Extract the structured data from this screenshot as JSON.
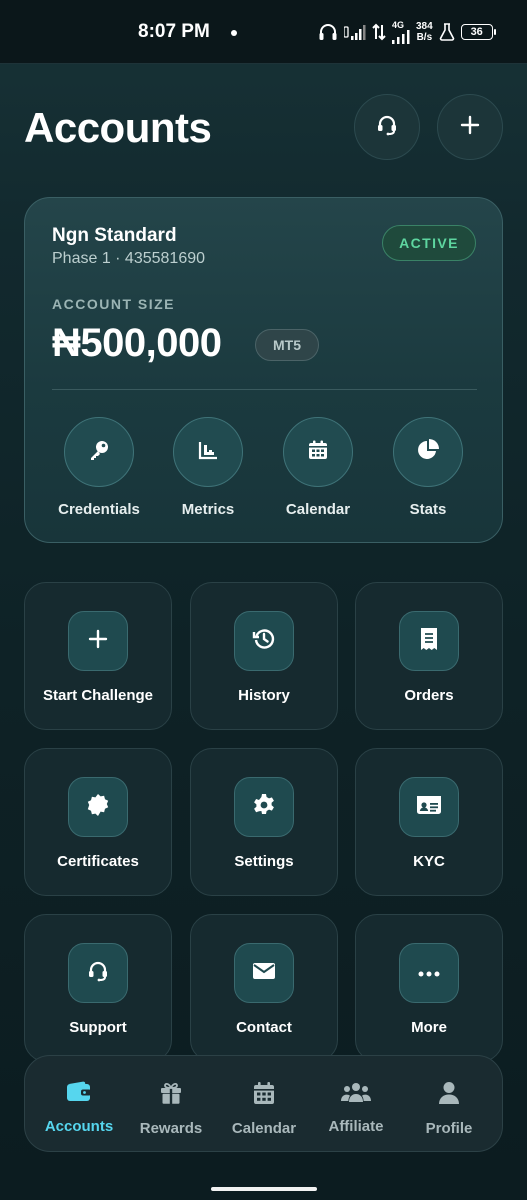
{
  "status_bar": {
    "time": "8:07 PM",
    "network": "4G",
    "speed_value": "384",
    "speed_unit": "B/s",
    "battery": "36"
  },
  "header": {
    "title": "Accounts"
  },
  "account": {
    "name": "Ngn Standard",
    "subtitle": "Phase 1 · 435581690",
    "status": "ACTIVE",
    "size_label": "ACCOUNT SIZE",
    "size_value": "₦500,000",
    "platform": "MT5",
    "actions": [
      {
        "label": "Credentials",
        "icon": "key-icon"
      },
      {
        "label": "Metrics",
        "icon": "bar-chart-icon"
      },
      {
        "label": "Calendar",
        "icon": "calendar-icon"
      },
      {
        "label": "Stats",
        "icon": "pie-chart-icon"
      }
    ]
  },
  "tiles": [
    {
      "label": "Start Challenge",
      "icon": "plus-icon"
    },
    {
      "label": "History",
      "icon": "history-icon"
    },
    {
      "label": "Orders",
      "icon": "receipt-icon"
    },
    {
      "label": "Certificates",
      "icon": "certificate-icon"
    },
    {
      "label": "Settings",
      "icon": "gear-icon"
    },
    {
      "label": "KYC",
      "icon": "id-card-icon"
    },
    {
      "label": "Support",
      "icon": "headset-icon"
    },
    {
      "label": "Contact",
      "icon": "envelope-icon"
    },
    {
      "label": "More",
      "icon": "more-icon"
    }
  ],
  "bottom_nav": [
    {
      "label": "Accounts",
      "icon": "wallet-icon",
      "active": true
    },
    {
      "label": "Rewards",
      "icon": "gift-icon",
      "active": false
    },
    {
      "label": "Calendar",
      "icon": "calendar-icon",
      "active": false
    },
    {
      "label": "Affiliate",
      "icon": "users-icon",
      "active": false
    },
    {
      "label": "Profile",
      "icon": "user-icon",
      "active": false
    }
  ],
  "colors": {
    "accent": "#56d6ee",
    "active_badge": "#5ed6a0",
    "icon": "#ffffff"
  }
}
